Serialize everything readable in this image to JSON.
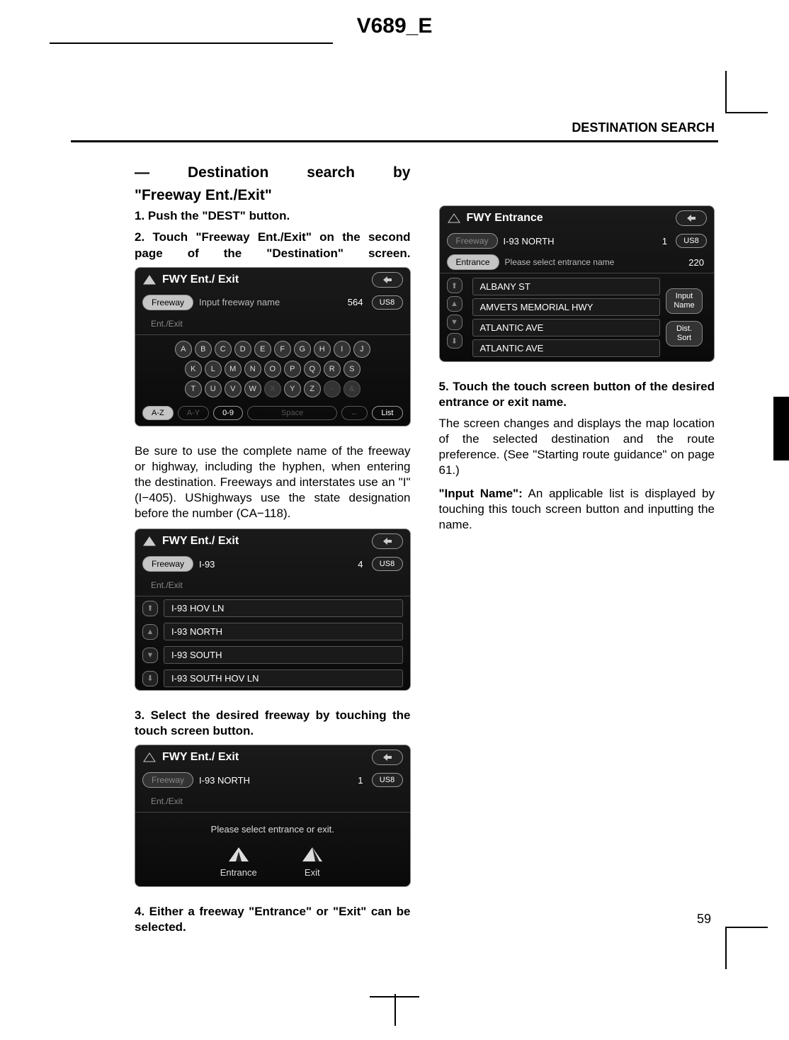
{
  "doc_id": "V689_E",
  "section": "DESTINATION SEARCH",
  "page_number": "59",
  "heading_line1": "— Destination search by",
  "heading_line2": "\"Freeway Ent./Exit\"",
  "step1": "1.  Push the \"DEST\" button.",
  "step2": "2.  Touch \"Freeway Ent./Exit\" on the second page of the \"Destination\" screen.",
  "body1": "Be sure to use the complete name of the freeway or highway, including the hy­phen, when entering the destination. Freeways and interstates use an \"I\" (I−405). UShighways use the state des­ignation before the number (CA−118).",
  "step3": "3.  Select the desired freeway by touching the touch screen button.",
  "step4": "4.  Either a freeway \"Entrance\" or \"Exit\" can be selected.",
  "step5": "5.  Touch the touch screen button of the desired entrance or exit name.",
  "body2": "The screen changes and displays the map location of the selected destination and the route preference. (See \"Starting route guidance\" on page 61.)",
  "input_note_label": "\"Input Name\":",
  "input_note_text": " An applicable list is dis­played by touching this touch screen button and inputting the name.",
  "screen1": {
    "title": "FWY Ent./ Exit",
    "tab1": "Freeway",
    "placeholder": "Input freeway name",
    "count": "564",
    "us8": "US8",
    "tab2": "Ent./Exit",
    "keys_r1": [
      "A",
      "B",
      "C",
      "D",
      "E",
      "F",
      "G",
      "H",
      "I",
      "J"
    ],
    "keys_r2": [
      "K",
      "L",
      "M",
      "N",
      "O",
      "P",
      "Q",
      "R",
      "S"
    ],
    "keys_r3": [
      "T",
      "U",
      "V",
      "W",
      "X",
      "Y",
      "Z",
      "-",
      "&"
    ],
    "bottom": {
      "az": "A-Z",
      "ay": "A-Y",
      "num": "0-9",
      "space": "Space",
      "back": "←",
      "list": "List"
    }
  },
  "screen2": {
    "title": "FWY Ent./ Exit",
    "tab1": "Freeway",
    "value": "I-93",
    "count": "4",
    "us8": "US8",
    "tab2": "Ent./Exit",
    "items": [
      "I-93 HOV LN",
      "I-93 NORTH",
      "I-93 SOUTH",
      "I-93 SOUTH HOV LN"
    ]
  },
  "screen3": {
    "title": "FWY Ent./ Exit",
    "tab1": "Freeway",
    "value": "I-93 NORTH",
    "count": "1",
    "us8": "US8",
    "tab2": "Ent./Exit",
    "prompt": "Please select entrance or exit.",
    "entrance": "Entrance",
    "exit": "Exit"
  },
  "screen4": {
    "title": "FWY Entrance",
    "tab1": "Freeway",
    "value": "I-93 NORTH",
    "count": "1",
    "us8": "US8",
    "tab2": "Entrance",
    "placeholder": "Please select entrance name",
    "count2": "220",
    "items": [
      "ALBANY ST",
      "AMVETS MEMORIAL HWY",
      "ATLANTIC AVE",
      "ATLANTIC AVE"
    ],
    "btn1_l1": "Input",
    "btn1_l2": "Name",
    "btn2_l1": "Dist.",
    "btn2_l2": "Sort"
  }
}
